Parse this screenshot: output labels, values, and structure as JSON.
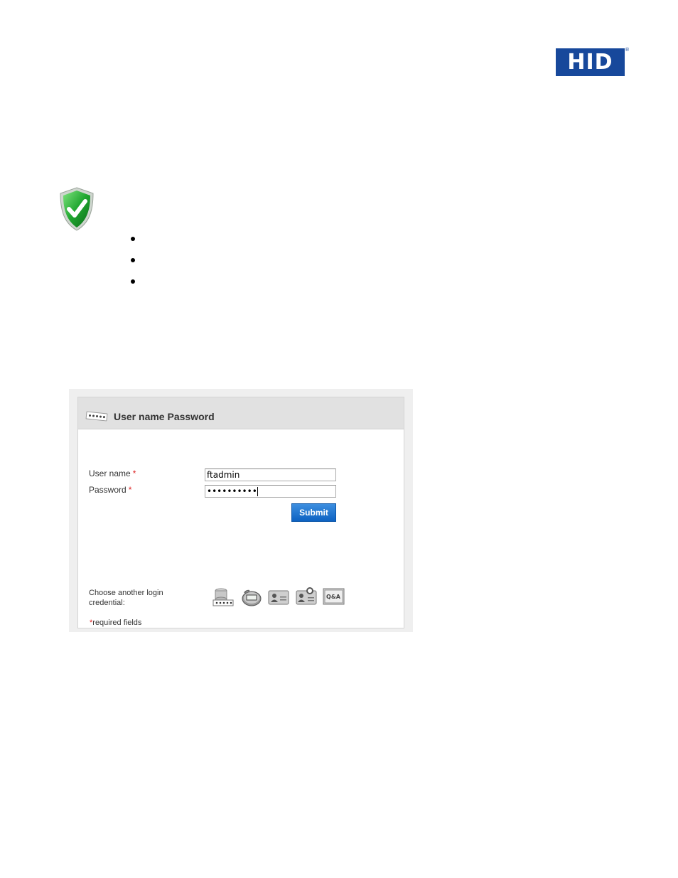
{
  "logo": {
    "text": "HID",
    "reg_mark": "®",
    "brand_color": "#17489b"
  },
  "bullets": [
    "",
    "",
    ""
  ],
  "login_panel": {
    "title": "User name Password",
    "username_label": "User name",
    "password_label": "Password",
    "required_mark": "*",
    "username_value": "ftadmin",
    "password_value": "••••••••••",
    "submit_label": "Submit",
    "choose_label": "Choose another login credential:",
    "credential_icons": [
      "database-otp-icon",
      "token-icon",
      "smart-card-icon",
      "badge-card-icon",
      "qa-icon"
    ],
    "qa_icon_text": "Q&A",
    "required_note": "required fields",
    "accent_color": "#0d62c2",
    "required_color": "#d22222"
  }
}
